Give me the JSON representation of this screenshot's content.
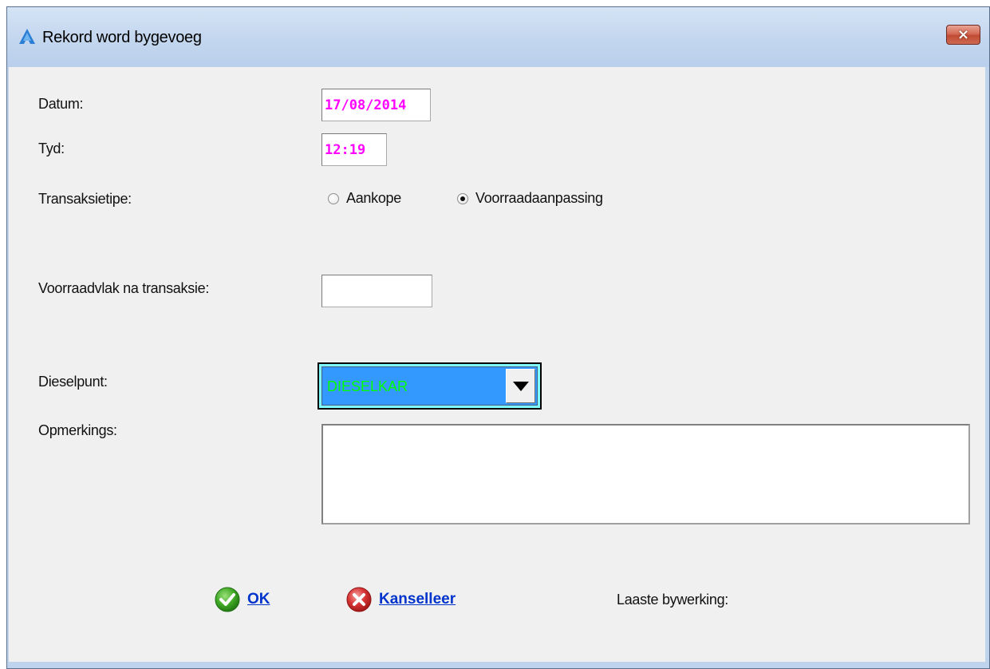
{
  "window": {
    "title": "Rekord word bygevoeg",
    "close_label": "×"
  },
  "form": {
    "datum": {
      "label": "Datum:",
      "value": "17/08/2014"
    },
    "tyd": {
      "label": "Tyd:",
      "value": "12:19"
    },
    "transaksietipe": {
      "label": "Transaksietipe:",
      "options": [
        {
          "label": "Aankope",
          "checked": false
        },
        {
          "label": "Voorraadaanpassing",
          "checked": true
        }
      ]
    },
    "voorraadvlak": {
      "label": "Voorraadvlak na transaksie:",
      "value": ""
    },
    "dieselpunt": {
      "label": "Dieselpunt:",
      "selected": "DIESELKAR"
    },
    "opmerkings": {
      "label": "Opmerkings:",
      "value": ""
    },
    "laaste_bywerking": {
      "label": "Laaste bywerking:"
    }
  },
  "buttons": {
    "ok": {
      "label": "OK",
      "icon": "check-icon"
    },
    "cancel": {
      "label": "Kanselleer",
      "icon": "cancel-icon"
    }
  },
  "colors": {
    "field_value": "#ff00ff",
    "combo_bg": "#3399ff",
    "combo_text": "#00ff00",
    "combo_focus": "#7fffff",
    "link": "#0033cc"
  }
}
